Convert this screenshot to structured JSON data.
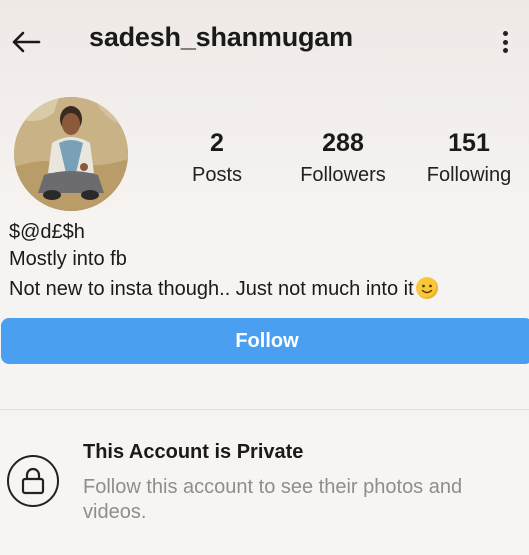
{
  "header": {
    "username": "sadesh_shanmugam",
    "back_icon": "arrow-left-icon",
    "more_icon": "vertical-dots-icon"
  },
  "profile": {
    "avatar_icon": "profile-photo",
    "stats": [
      {
        "value": "2",
        "label": "Posts"
      },
      {
        "value": "288",
        "label": "Followers"
      },
      {
        "value": "151",
        "label": "Following"
      }
    ],
    "bio": {
      "name": "$@d£$h",
      "line1": "Mostly into fb",
      "line2": "Not new to insta though.. Just not much into it"
    }
  },
  "actions": {
    "follow_label": "Follow"
  },
  "private_notice": {
    "title": "This Account is Private",
    "description": "Follow this account to see their photos and videos.",
    "icon": "lock-icon"
  },
  "colors": {
    "follow_button": "#4a9ff0",
    "muted_text": "#8e8e8e"
  }
}
